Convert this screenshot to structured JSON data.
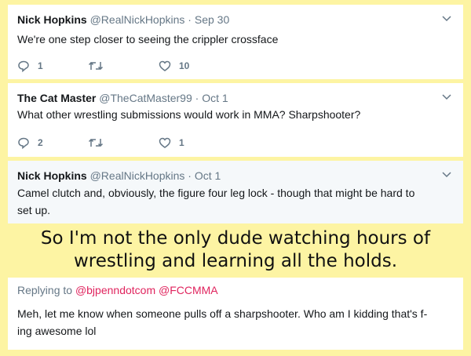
{
  "tweets": [
    {
      "name": "Nick Hopkins",
      "handle": "@RealNickHopkins",
      "sep": " · ",
      "date": "Sep 30",
      "text": "We're one step closer to seeing the crippler crossface",
      "replies": "1",
      "retweets": "",
      "likes": "10"
    },
    {
      "name": "The Cat Master",
      "handle": "@TheCatMaster99",
      "sep": " · ",
      "date": "Oct 1",
      "text": "What other wrestling submissions would work in MMA? Sharpshooter?",
      "replies": "2",
      "retweets": "",
      "likes": "1"
    },
    {
      "name": "Nick Hopkins",
      "handle": "@RealNickHopkins",
      "sep": " · ",
      "date": "Oct 1",
      "text": "Camel clutch and, obviously, the figure four leg lock - though that might be hard to set up."
    }
  ],
  "caption": "So I'm not the only dude watching hours of wrestling and learning all the holds.",
  "reply": {
    "prefix": "Replying to",
    "mention1": "@bjpenndotcom",
    "mention2": "@FCCMMA",
    "text": "Meh, let me know when someone pulls off a sharpshooter. Who am I kidding that's f-ing awesome lol"
  },
  "colors": {
    "background": "#fdf4a3",
    "muted": "#657786",
    "mention": "#e0245e"
  },
  "icons": [
    "reply-icon",
    "retweet-icon",
    "like-icon",
    "chevron-down-icon"
  ]
}
